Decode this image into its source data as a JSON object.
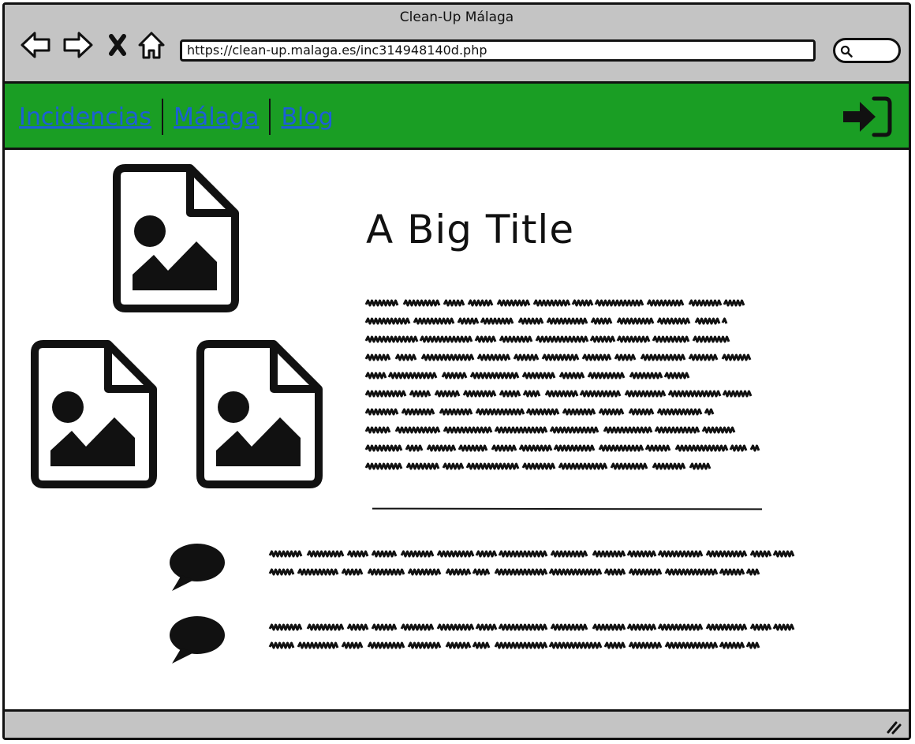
{
  "window": {
    "title": "Clean-Up Málaga",
    "url": "https://clean-up.malaga.es/inc314948140d.php"
  },
  "toolbar": {
    "back_icon": "back-arrow-icon",
    "forward_icon": "forward-arrow-icon",
    "stop_icon": "close-icon",
    "home_icon": "home-icon",
    "search_icon": "search-icon"
  },
  "nav": {
    "links": [
      "Incidencias",
      "Málaga",
      "Blog"
    ],
    "login_icon": "sign-in-icon"
  },
  "content": {
    "title": "A Big Title",
    "image_icons": [
      "image-icon",
      "image-icon",
      "image-icon"
    ],
    "comment_icon": "speech-bubble-icon"
  },
  "colors": {
    "chrome": "#c4c4c4",
    "nav_bg": "#1a9e24",
    "link": "#1c5fd6",
    "ink": "#111111"
  }
}
